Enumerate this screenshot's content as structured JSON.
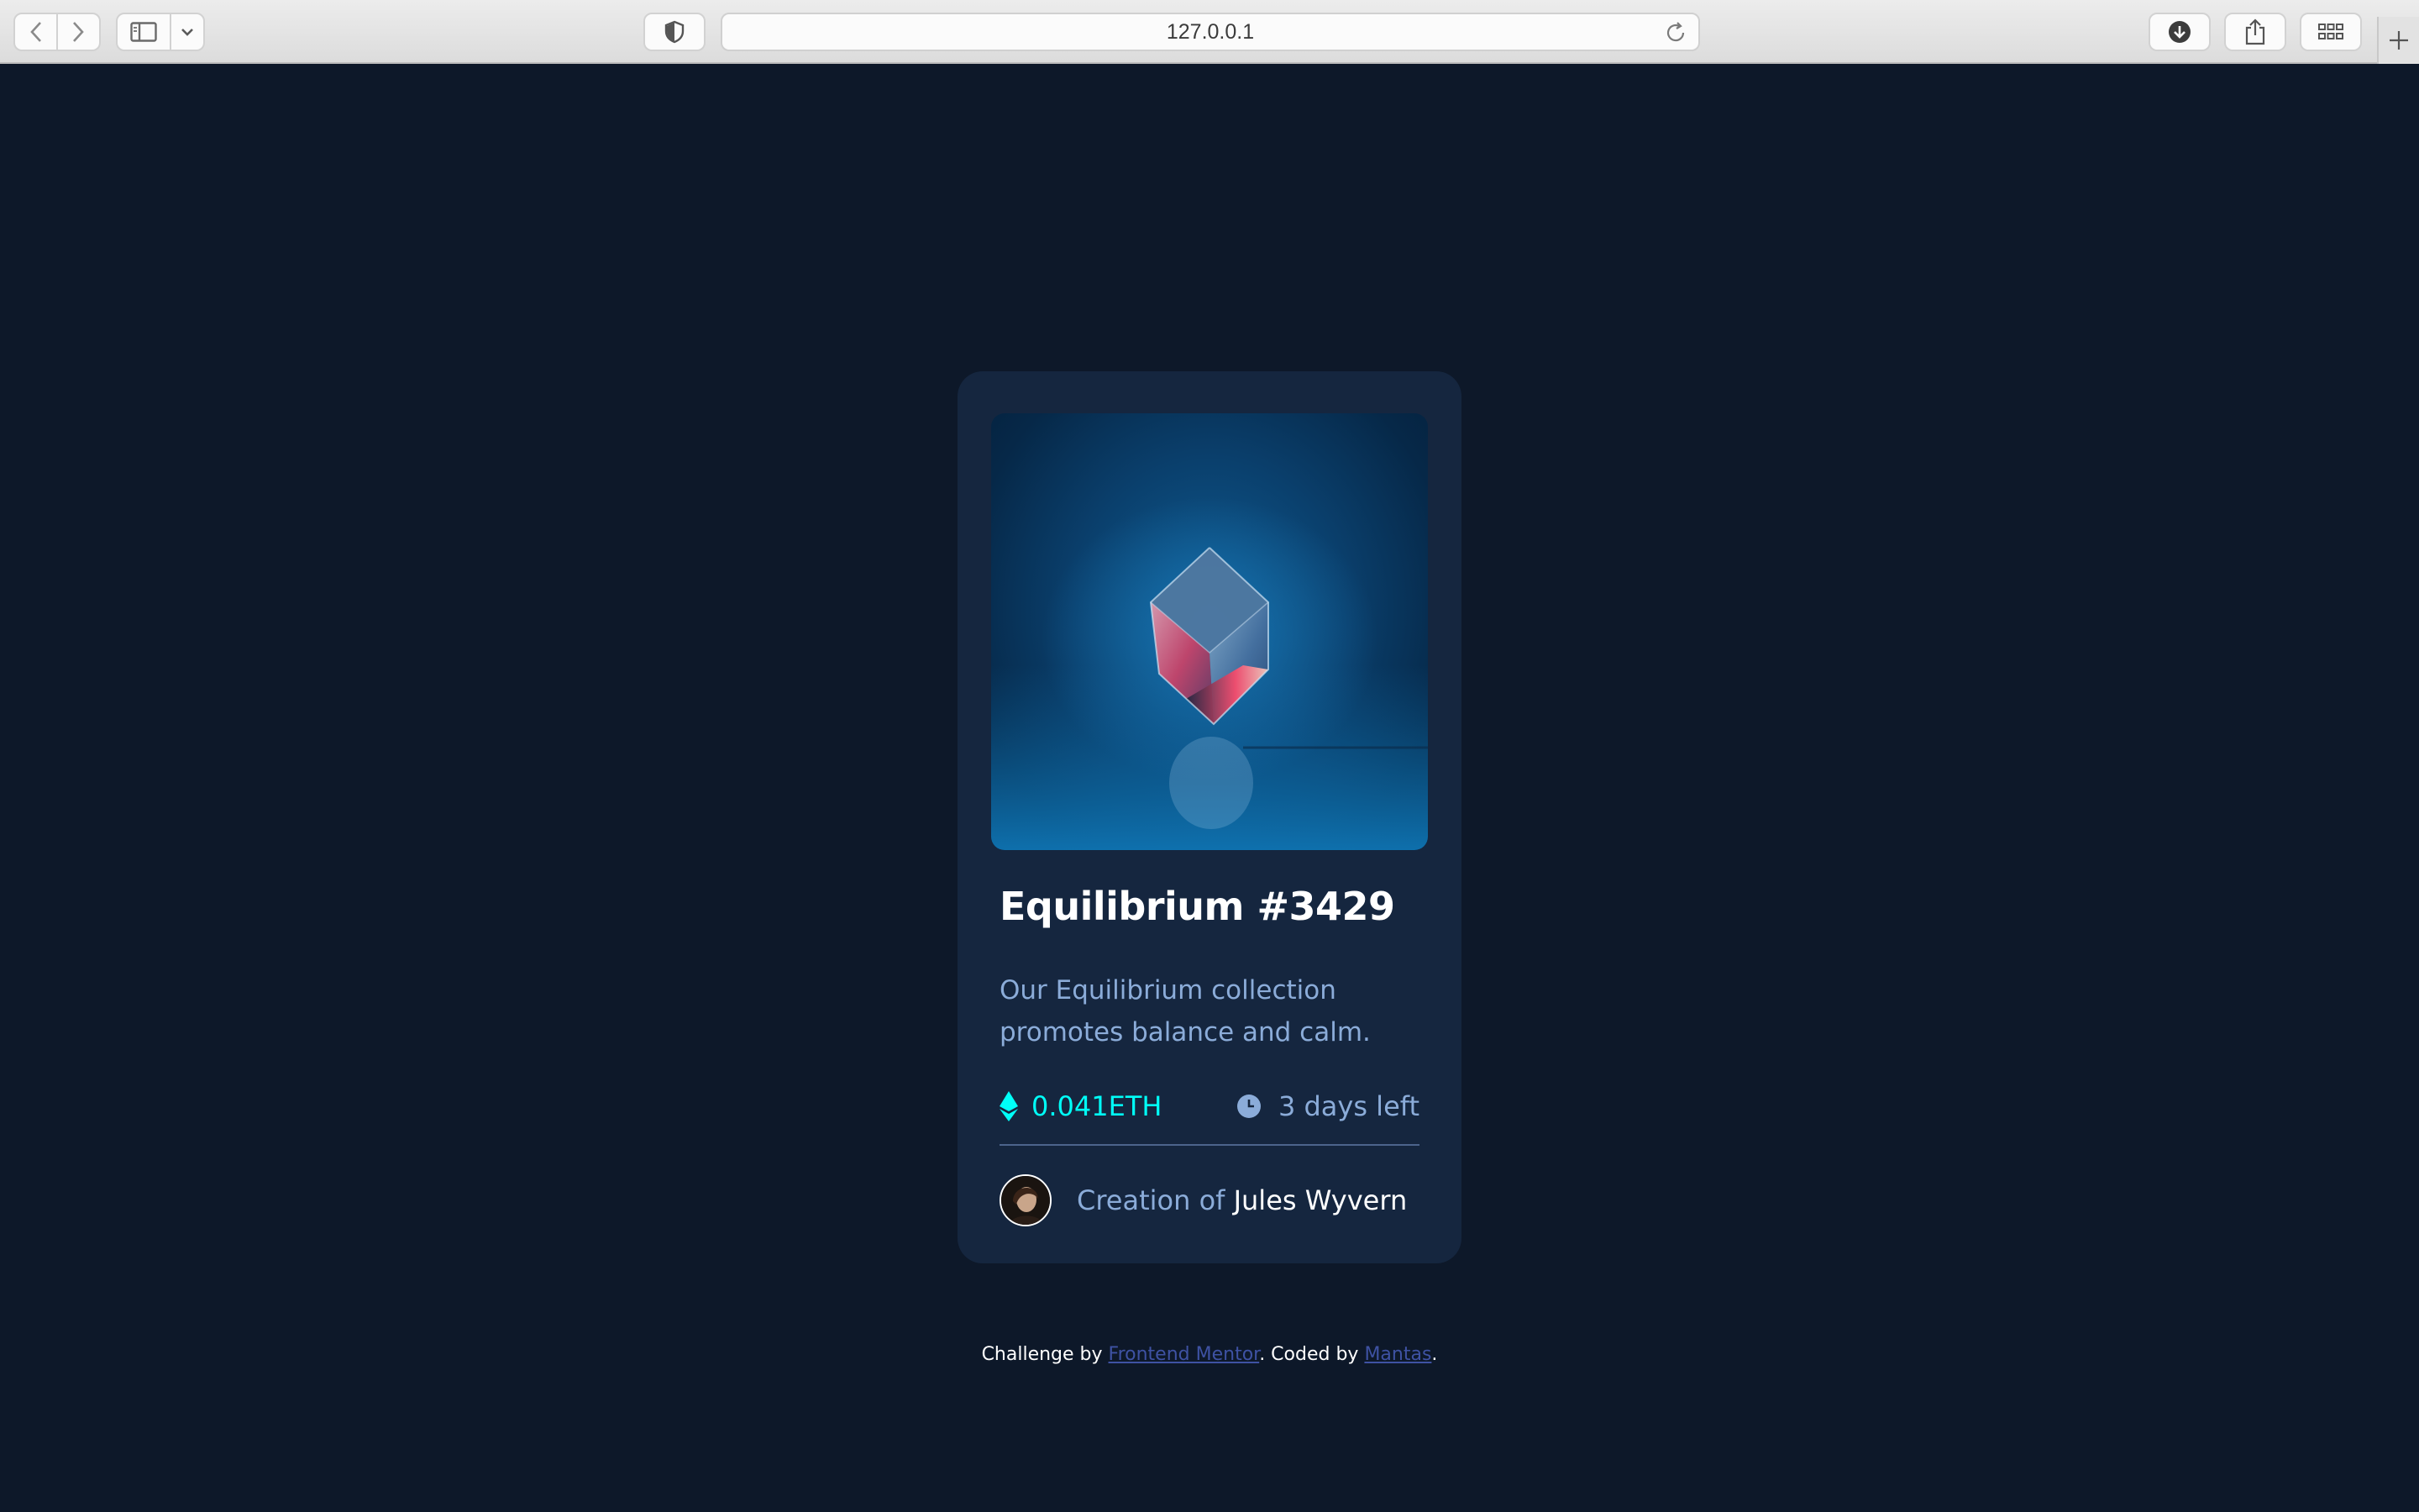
{
  "browser": {
    "url": "127.0.0.1",
    "icons": {
      "back": "chevron-left-icon",
      "forward": "chevron-right-icon",
      "sidebar": "sidebar-icon",
      "sidebar_menu": "chevron-down-icon",
      "privacy": "shield-icon",
      "reload": "reload-icon",
      "downloads": "download-icon",
      "share": "share-icon",
      "tabs": "grid-icon",
      "new_tab": "plus-icon"
    }
  },
  "card": {
    "title": "Equilibrium #3429",
    "description": "Our Equilibrium collection promotes balance and calm.",
    "price": "0.041ETH",
    "time_left": "3 days left",
    "creator_prefix": "Creation of",
    "creator_name": "Jules Wyvern",
    "icons": {
      "price": "ethereum-icon",
      "time": "clock-icon"
    },
    "colors": {
      "background": "#0d1829",
      "card": "#15263f",
      "accent": "#00fff8",
      "soft_blue": "#8bacd9",
      "white": "#ffffff"
    }
  },
  "footer": {
    "prefix": "Challenge by",
    "link1": "Frontend Mentor",
    "middle": ". Coded by",
    "link2": "Mantas",
    "suffix": ".",
    "link_color": "#3e52a3"
  }
}
